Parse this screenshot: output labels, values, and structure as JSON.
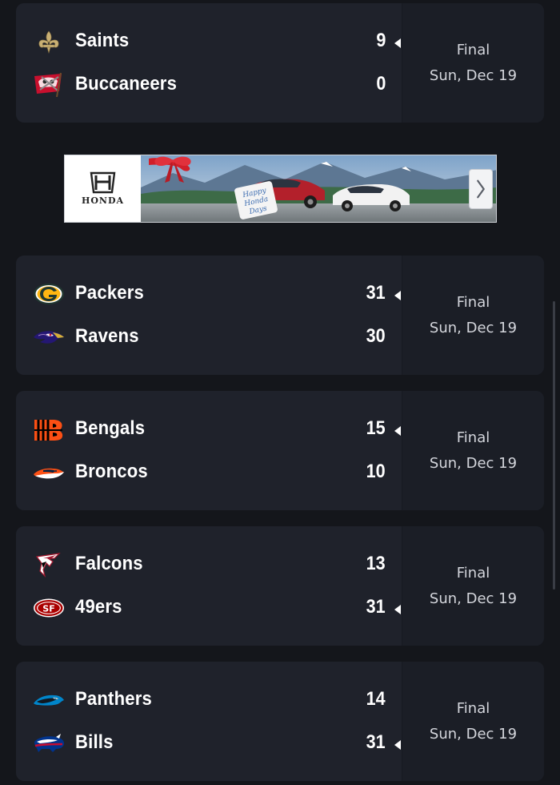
{
  "games": [
    {
      "home": {
        "name": "Saints",
        "score": "9",
        "logo": "saints-fleur-de-lis-icon",
        "winner": true
      },
      "away": {
        "name": "Buccaneers",
        "score": "0",
        "logo": "buccaneers-flag-icon",
        "winner": false
      },
      "status": "Final",
      "date": "Sun, Dec 19"
    },
    {
      "home": {
        "name": "Packers",
        "score": "31",
        "logo": "packers-g-icon",
        "winner": true
      },
      "away": {
        "name": "Ravens",
        "score": "30",
        "logo": "ravens-head-icon",
        "winner": false
      },
      "status": "Final",
      "date": "Sun, Dec 19"
    },
    {
      "home": {
        "name": "Bengals",
        "score": "15",
        "logo": "bengals-b-icon",
        "winner": true
      },
      "away": {
        "name": "Broncos",
        "score": "10",
        "logo": "broncos-horse-icon",
        "winner": false
      },
      "status": "Final",
      "date": "Sun, Dec 19"
    },
    {
      "home": {
        "name": "Falcons",
        "score": "13",
        "logo": "falcons-bird-icon",
        "winner": false
      },
      "away": {
        "name": "49ers",
        "score": "31",
        "logo": "49ers-oval-icon",
        "winner": true
      },
      "status": "Final",
      "date": "Sun, Dec 19"
    },
    {
      "home": {
        "name": "Panthers",
        "score": "14",
        "logo": "panthers-head-icon",
        "winner": false
      },
      "away": {
        "name": "Bills",
        "score": "31",
        "logo": "bills-buffalo-icon",
        "winner": true
      },
      "status": "Final",
      "date": "Sun, Dec 19"
    }
  ],
  "ad": {
    "brand": "HONDA",
    "tag_text": "Happy Honda Days",
    "next_icon": "chevron-right-icon"
  },
  "colors": {
    "background": "#14161b",
    "card": "#1f222b",
    "status_column": "#1b1e26",
    "text": "#ffffff",
    "muted_text": "#d4d6dc"
  }
}
